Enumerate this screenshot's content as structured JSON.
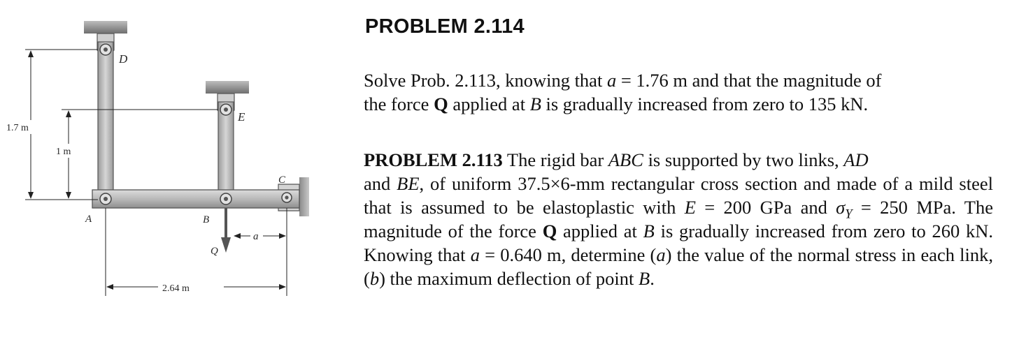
{
  "figure": {
    "labels": {
      "D": "D",
      "E": "E",
      "A": "A",
      "B": "B",
      "C": "C",
      "Q": "Q",
      "a": "a",
      "dim_1_7": "1.7 m",
      "dim_1": "1 m",
      "dim_2_64": "2.64 m"
    }
  },
  "problem_114": {
    "title": "PROBLEM 2.114",
    "p1_t1": "Solve Prob. 2.113, knowing that ",
    "p1_a": "a",
    "p1_t2": " = 1.76 m and that the magnitude of",
    "p1_t3": "the force ",
    "p1_Q": "Q",
    "p1_t4": " applied at ",
    "p1_B": "B",
    "p1_t5": " is gradually increased from zero to 135 kN."
  },
  "problem_113": {
    "title": "PROBLEM 2.113",
    "t1": " The rigid bar ",
    "ABC": "ABC",
    "t2": " is supported by two links, ",
    "AD": "AD",
    "t3": "and ",
    "BE": "BE",
    "t4": ", of uniform 37.5×6-mm rectangular cross section and made of a mild steel that is assumed to be elastoplastic with ",
    "E": "E",
    "t5": " = 200 GPa and ",
    "sigma": "σ",
    "sigma_sub": "Y",
    "t6": " = 250 MPa. The magnitude of the force ",
    "Q": "Q",
    "t7": " applied at ",
    "B": "B",
    "t8": " is gradually increased from zero to 260 kN. Knowing that ",
    "a": "a",
    "t9": " = 0.640 m, determine (",
    "pa": "a",
    "t10": ") the value of the normal stress in each link, (",
    "pb": "b",
    "t11": ") the maximum deflection of point ",
    "B2": "B",
    "t12": "."
  }
}
